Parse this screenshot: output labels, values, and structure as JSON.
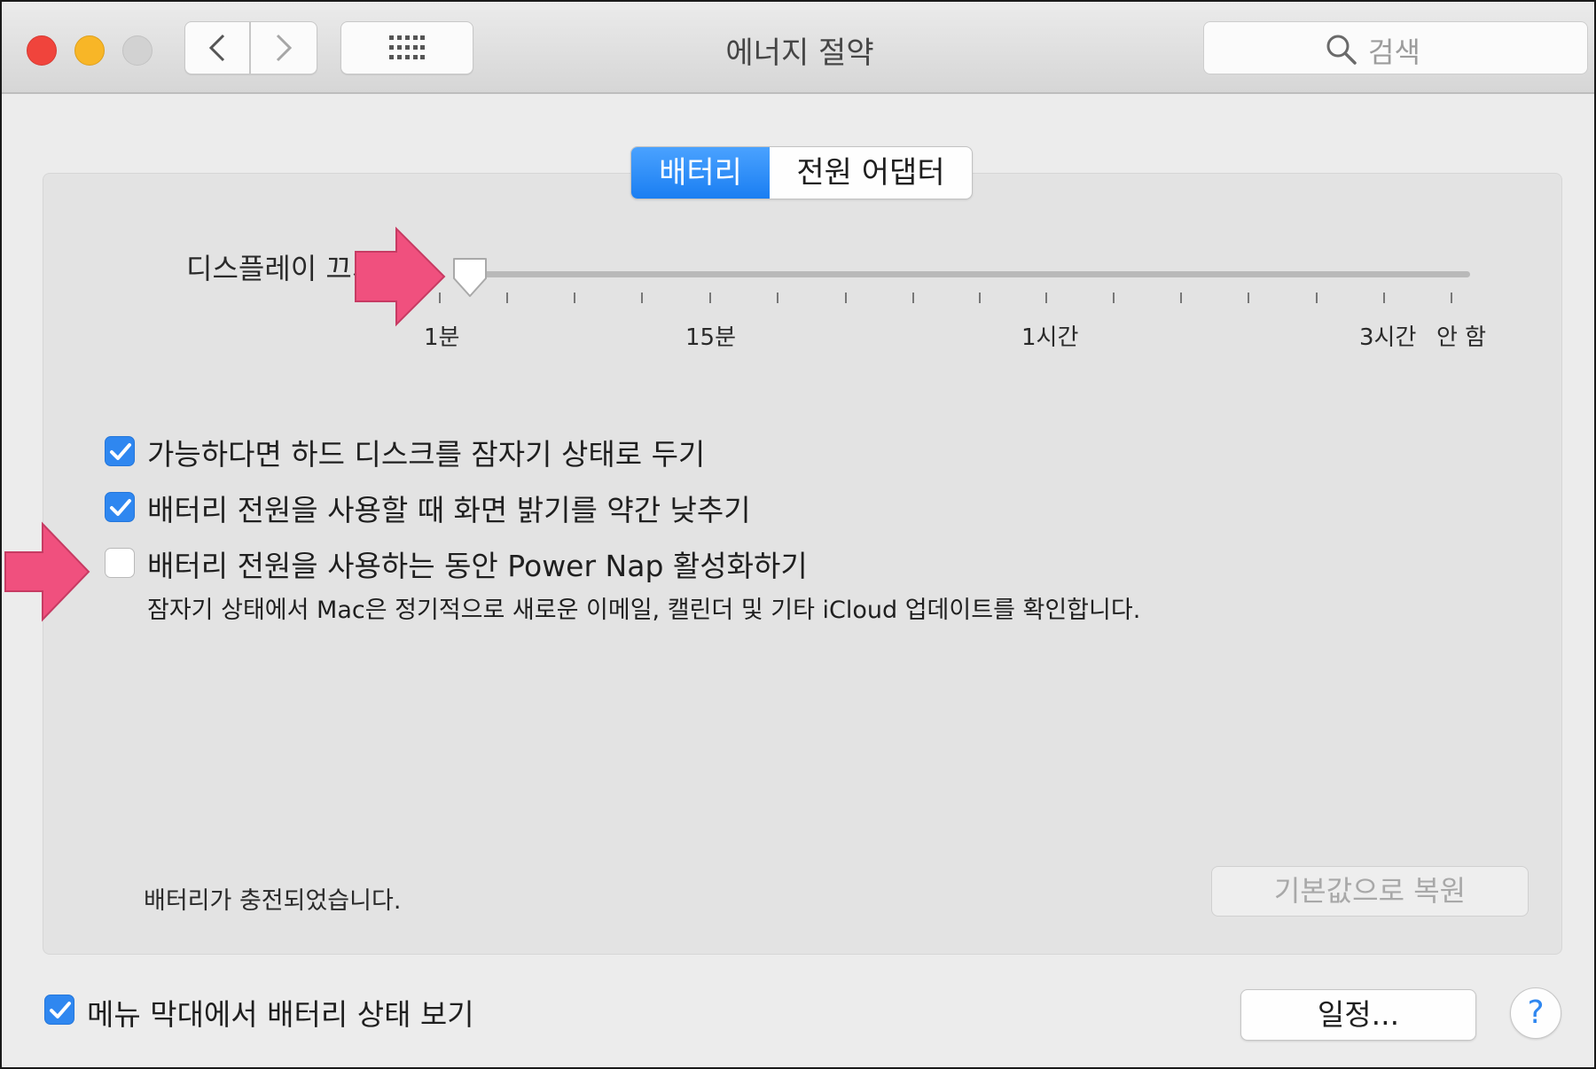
{
  "window": {
    "title": "에너지 절약"
  },
  "search": {
    "placeholder": "검색"
  },
  "tabs": [
    {
      "label": "배터리",
      "selected": true
    },
    {
      "label": "전원 어댑터",
      "selected": false
    }
  ],
  "display_sleep": {
    "label": "디스플레이 끄기",
    "value": "1분",
    "ticks": [
      "1분",
      "15분",
      "1시간",
      "3시간",
      "안 함"
    ]
  },
  "options": [
    {
      "label": "가능하다면 하드 디스크를 잠자기 상태로 두기",
      "checked": true
    },
    {
      "label": "배터리 전원을 사용할 때 화면 밝기를 약간 낮추기",
      "checked": true
    },
    {
      "label": "배터리 전원을 사용하는 동안 Power Nap 활성화하기",
      "checked": false
    }
  ],
  "power_nap_description": "잠자기 상태에서 Mac은 정기적으로 새로운 이메일, 캘린더 및 기타 iCloud 업데이트를 확인합니다.",
  "battery_status": "배터리가 충전되었습니다.",
  "restore_defaults_label": "기본값으로 복원",
  "menu_bar": {
    "label": "메뉴 막대에서 배터리 상태 보기",
    "checked": true
  },
  "schedule_label": "일정...",
  "help_label": "?",
  "colors": {
    "accent": "#2f87f0",
    "annotation_arrow": "#f0507e"
  }
}
